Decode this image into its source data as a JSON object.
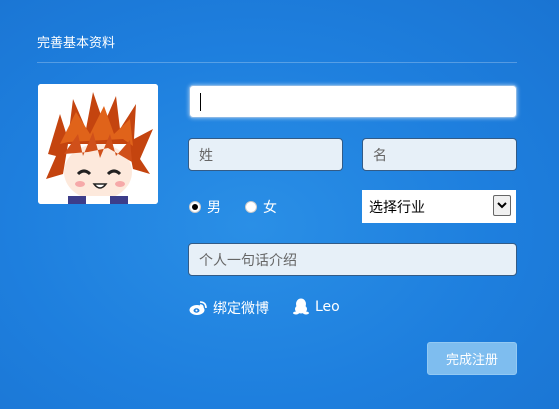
{
  "page": {
    "title": "完善基本资料"
  },
  "form": {
    "username_value": "",
    "last_name_placeholder": "姓",
    "first_name_placeholder": "名",
    "gender": {
      "male_label": "男",
      "female_label": "女",
      "selected": "male"
    },
    "industry_select": {
      "selected_label": "选择行业"
    },
    "bio_placeholder": "个人一句话介绍"
  },
  "social": {
    "weibo_label": "绑定微博",
    "qq_label": "Leo"
  },
  "actions": {
    "submit_label": "完成注册"
  }
}
